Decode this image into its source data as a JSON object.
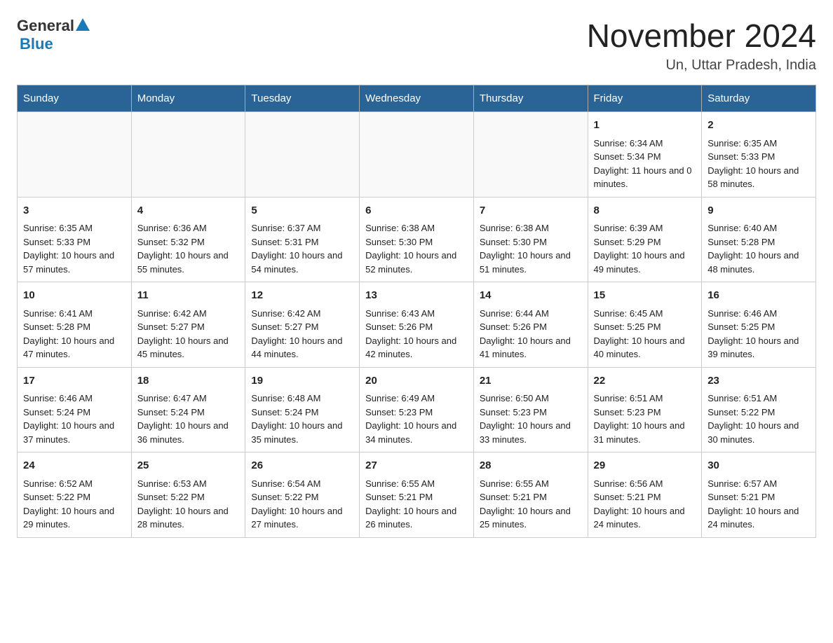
{
  "header": {
    "title": "November 2024",
    "location": "Un, Uttar Pradesh, India",
    "logo_general": "General",
    "logo_blue": "Blue"
  },
  "weekdays": [
    "Sunday",
    "Monday",
    "Tuesday",
    "Wednesday",
    "Thursday",
    "Friday",
    "Saturday"
  ],
  "rows": [
    [
      {
        "day": "",
        "sunrise": "",
        "sunset": "",
        "daylight": ""
      },
      {
        "day": "",
        "sunrise": "",
        "sunset": "",
        "daylight": ""
      },
      {
        "day": "",
        "sunrise": "",
        "sunset": "",
        "daylight": ""
      },
      {
        "day": "",
        "sunrise": "",
        "sunset": "",
        "daylight": ""
      },
      {
        "day": "",
        "sunrise": "",
        "sunset": "",
        "daylight": ""
      },
      {
        "day": "1",
        "sunrise": "Sunrise: 6:34 AM",
        "sunset": "Sunset: 5:34 PM",
        "daylight": "Daylight: 11 hours and 0 minutes."
      },
      {
        "day": "2",
        "sunrise": "Sunrise: 6:35 AM",
        "sunset": "Sunset: 5:33 PM",
        "daylight": "Daylight: 10 hours and 58 minutes."
      }
    ],
    [
      {
        "day": "3",
        "sunrise": "Sunrise: 6:35 AM",
        "sunset": "Sunset: 5:33 PM",
        "daylight": "Daylight: 10 hours and 57 minutes."
      },
      {
        "day": "4",
        "sunrise": "Sunrise: 6:36 AM",
        "sunset": "Sunset: 5:32 PM",
        "daylight": "Daylight: 10 hours and 55 minutes."
      },
      {
        "day": "5",
        "sunrise": "Sunrise: 6:37 AM",
        "sunset": "Sunset: 5:31 PM",
        "daylight": "Daylight: 10 hours and 54 minutes."
      },
      {
        "day": "6",
        "sunrise": "Sunrise: 6:38 AM",
        "sunset": "Sunset: 5:30 PM",
        "daylight": "Daylight: 10 hours and 52 minutes."
      },
      {
        "day": "7",
        "sunrise": "Sunrise: 6:38 AM",
        "sunset": "Sunset: 5:30 PM",
        "daylight": "Daylight: 10 hours and 51 minutes."
      },
      {
        "day": "8",
        "sunrise": "Sunrise: 6:39 AM",
        "sunset": "Sunset: 5:29 PM",
        "daylight": "Daylight: 10 hours and 49 minutes."
      },
      {
        "day": "9",
        "sunrise": "Sunrise: 6:40 AM",
        "sunset": "Sunset: 5:28 PM",
        "daylight": "Daylight: 10 hours and 48 minutes."
      }
    ],
    [
      {
        "day": "10",
        "sunrise": "Sunrise: 6:41 AM",
        "sunset": "Sunset: 5:28 PM",
        "daylight": "Daylight: 10 hours and 47 minutes."
      },
      {
        "day": "11",
        "sunrise": "Sunrise: 6:42 AM",
        "sunset": "Sunset: 5:27 PM",
        "daylight": "Daylight: 10 hours and 45 minutes."
      },
      {
        "day": "12",
        "sunrise": "Sunrise: 6:42 AM",
        "sunset": "Sunset: 5:27 PM",
        "daylight": "Daylight: 10 hours and 44 minutes."
      },
      {
        "day": "13",
        "sunrise": "Sunrise: 6:43 AM",
        "sunset": "Sunset: 5:26 PM",
        "daylight": "Daylight: 10 hours and 42 minutes."
      },
      {
        "day": "14",
        "sunrise": "Sunrise: 6:44 AM",
        "sunset": "Sunset: 5:26 PM",
        "daylight": "Daylight: 10 hours and 41 minutes."
      },
      {
        "day": "15",
        "sunrise": "Sunrise: 6:45 AM",
        "sunset": "Sunset: 5:25 PM",
        "daylight": "Daylight: 10 hours and 40 minutes."
      },
      {
        "day": "16",
        "sunrise": "Sunrise: 6:46 AM",
        "sunset": "Sunset: 5:25 PM",
        "daylight": "Daylight: 10 hours and 39 minutes."
      }
    ],
    [
      {
        "day": "17",
        "sunrise": "Sunrise: 6:46 AM",
        "sunset": "Sunset: 5:24 PM",
        "daylight": "Daylight: 10 hours and 37 minutes."
      },
      {
        "day": "18",
        "sunrise": "Sunrise: 6:47 AM",
        "sunset": "Sunset: 5:24 PM",
        "daylight": "Daylight: 10 hours and 36 minutes."
      },
      {
        "day": "19",
        "sunrise": "Sunrise: 6:48 AM",
        "sunset": "Sunset: 5:24 PM",
        "daylight": "Daylight: 10 hours and 35 minutes."
      },
      {
        "day": "20",
        "sunrise": "Sunrise: 6:49 AM",
        "sunset": "Sunset: 5:23 PM",
        "daylight": "Daylight: 10 hours and 34 minutes."
      },
      {
        "day": "21",
        "sunrise": "Sunrise: 6:50 AM",
        "sunset": "Sunset: 5:23 PM",
        "daylight": "Daylight: 10 hours and 33 minutes."
      },
      {
        "day": "22",
        "sunrise": "Sunrise: 6:51 AM",
        "sunset": "Sunset: 5:23 PM",
        "daylight": "Daylight: 10 hours and 31 minutes."
      },
      {
        "day": "23",
        "sunrise": "Sunrise: 6:51 AM",
        "sunset": "Sunset: 5:22 PM",
        "daylight": "Daylight: 10 hours and 30 minutes."
      }
    ],
    [
      {
        "day": "24",
        "sunrise": "Sunrise: 6:52 AM",
        "sunset": "Sunset: 5:22 PM",
        "daylight": "Daylight: 10 hours and 29 minutes."
      },
      {
        "day": "25",
        "sunrise": "Sunrise: 6:53 AM",
        "sunset": "Sunset: 5:22 PM",
        "daylight": "Daylight: 10 hours and 28 minutes."
      },
      {
        "day": "26",
        "sunrise": "Sunrise: 6:54 AM",
        "sunset": "Sunset: 5:22 PM",
        "daylight": "Daylight: 10 hours and 27 minutes."
      },
      {
        "day": "27",
        "sunrise": "Sunrise: 6:55 AM",
        "sunset": "Sunset: 5:21 PM",
        "daylight": "Daylight: 10 hours and 26 minutes."
      },
      {
        "day": "28",
        "sunrise": "Sunrise: 6:55 AM",
        "sunset": "Sunset: 5:21 PM",
        "daylight": "Daylight: 10 hours and 25 minutes."
      },
      {
        "day": "29",
        "sunrise": "Sunrise: 6:56 AM",
        "sunset": "Sunset: 5:21 PM",
        "daylight": "Daylight: 10 hours and 24 minutes."
      },
      {
        "day": "30",
        "sunrise": "Sunrise: 6:57 AM",
        "sunset": "Sunset: 5:21 PM",
        "daylight": "Daylight: 10 hours and 24 minutes."
      }
    ]
  ]
}
